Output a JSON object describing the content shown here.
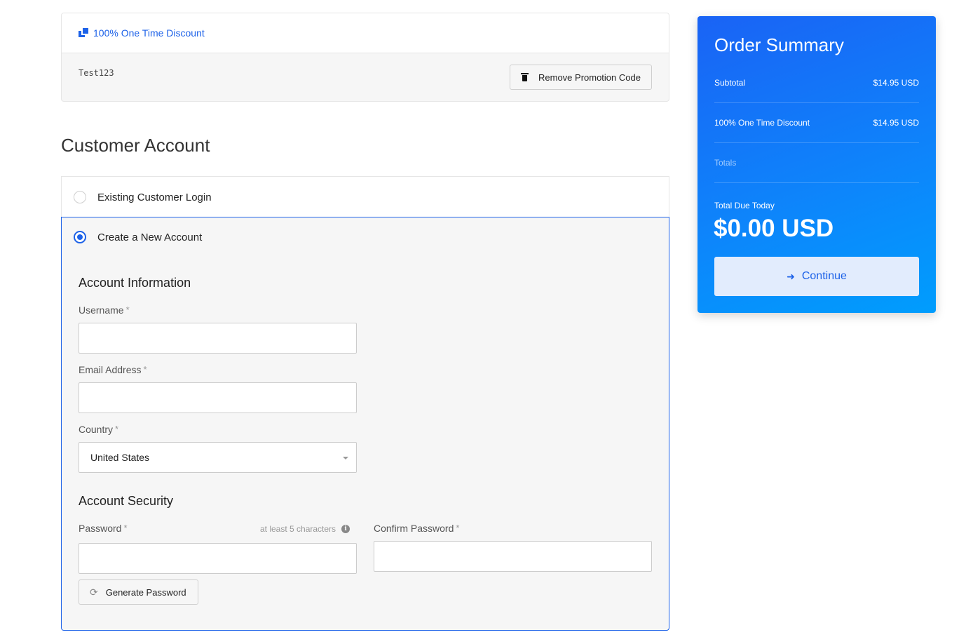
{
  "promo": {
    "title": "100% One Time Discount",
    "code": "Test123",
    "remove_label": "Remove Promotion Code"
  },
  "customer_account": {
    "title": "Customer Account",
    "existing_label": "Existing Customer Login",
    "new_label": "Create a New Account",
    "account_info_title": "Account Information",
    "username_label": "Username",
    "username_value": "",
    "email_label": "Email Address",
    "email_value": "",
    "country_label": "Country",
    "country_value": "United States",
    "security_title": "Account Security",
    "password_label": "Password",
    "password_hint": "at least 5 characters",
    "confirm_label": "Confirm Password",
    "generate_label": "Generate Password",
    "required_mark": "*",
    "selected_option": "new"
  },
  "summary": {
    "title": "Order Summary",
    "rows": [
      {
        "label": "Subtotal",
        "value": "$14.95 USD"
      },
      {
        "label": "100% One Time Discount",
        "value": "$14.95 USD"
      }
    ],
    "totals_label": "Totals",
    "due_label": "Total Due Today",
    "due_amount": "$0.00 USD",
    "continue_label": "Continue"
  },
  "colors": {
    "accent": "#1d62e8",
    "summary_gradient_start": "#1a63f5",
    "summary_gradient_end": "#009dfd"
  }
}
